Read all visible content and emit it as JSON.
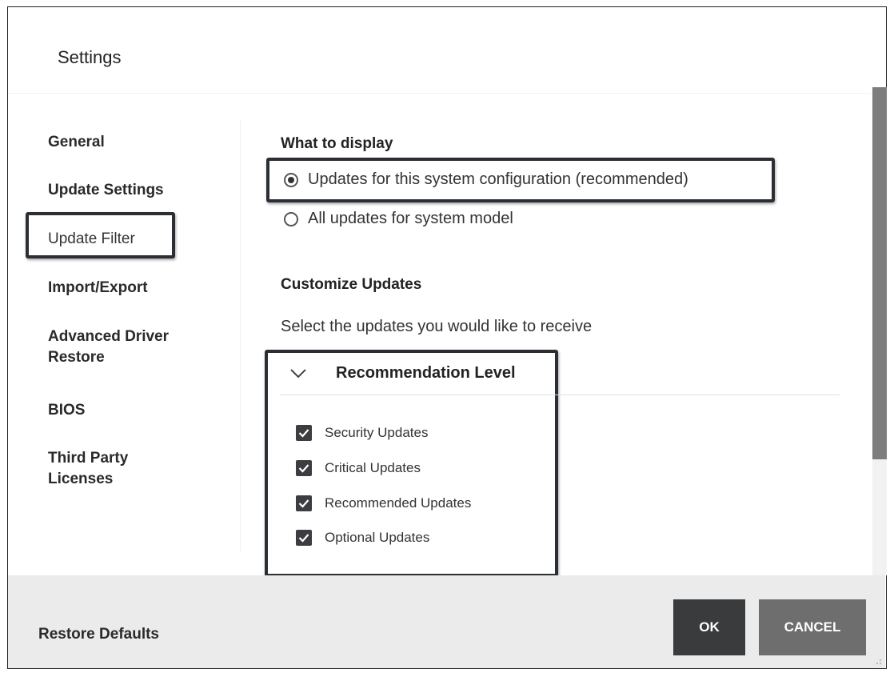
{
  "dialog": {
    "title": "Settings"
  },
  "sidebar": {
    "items": [
      {
        "label": "General"
      },
      {
        "label": "Update Settings"
      },
      {
        "label": "Update Filter"
      },
      {
        "label": "Import/Export"
      },
      {
        "label": "Advanced Driver Restore"
      },
      {
        "label": "BIOS"
      },
      {
        "label": "Third Party Licenses"
      }
    ],
    "selected": "Update Filter"
  },
  "display": {
    "heading": "What to display",
    "options": [
      {
        "label": "Updates for this system configuration (recommended)",
        "checked": true
      },
      {
        "label": "All updates for system model",
        "checked": false
      }
    ]
  },
  "customize": {
    "heading": "Customize Updates",
    "description": "Select the updates you would like to receive",
    "group": {
      "title": "Recommendation Level",
      "icon": "chevron-down-icon",
      "items": [
        {
          "label": "Security Updates",
          "checked": true
        },
        {
          "label": "Critical Updates",
          "checked": true
        },
        {
          "label": "Recommended Updates",
          "checked": true
        },
        {
          "label": "Optional Updates",
          "checked": true
        }
      ]
    }
  },
  "footer": {
    "restore_label": "Restore Defaults",
    "ok_label": "OK",
    "cancel_label": "CANCEL"
  },
  "colors": {
    "ok_button": "#3a3b3d",
    "cancel_button": "#6e6e6e",
    "footer_bg": "#ebebeb",
    "highlight_border": "#2b2f33"
  }
}
